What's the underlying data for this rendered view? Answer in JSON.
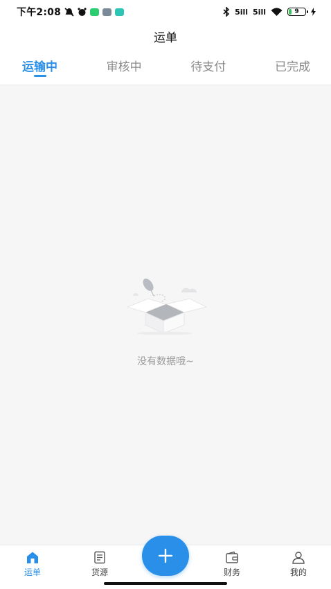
{
  "status_bar": {
    "time": "下午2:08",
    "signal_1": "5ill",
    "signal_2": "5ill",
    "battery_level": "9",
    "app_icon_colors": [
      "#2ecc71",
      "#7b8a99",
      "#2ec4b6"
    ]
  },
  "header": {
    "title": "运单"
  },
  "tabs": [
    {
      "label": "运输中",
      "active": true
    },
    {
      "label": "审核中",
      "active": false
    },
    {
      "label": "待支付",
      "active": false
    },
    {
      "label": "已完成",
      "active": false
    }
  ],
  "empty_state": {
    "message": "没有数据哦~",
    "icon": "empty-box-icon"
  },
  "bottom_nav": {
    "items": [
      {
        "label": "运单",
        "icon": "home-icon",
        "active": true
      },
      {
        "label": "货源",
        "icon": "document-icon",
        "active": false
      },
      {
        "label": "财务",
        "icon": "wallet-icon",
        "active": false
      },
      {
        "label": "我的",
        "icon": "user-icon",
        "active": false
      }
    ],
    "fab_icon": "plus-icon"
  },
  "colors": {
    "accent": "#2a8fe8",
    "background": "#f6f6f7",
    "inactive_text": "#8a8a8a"
  }
}
